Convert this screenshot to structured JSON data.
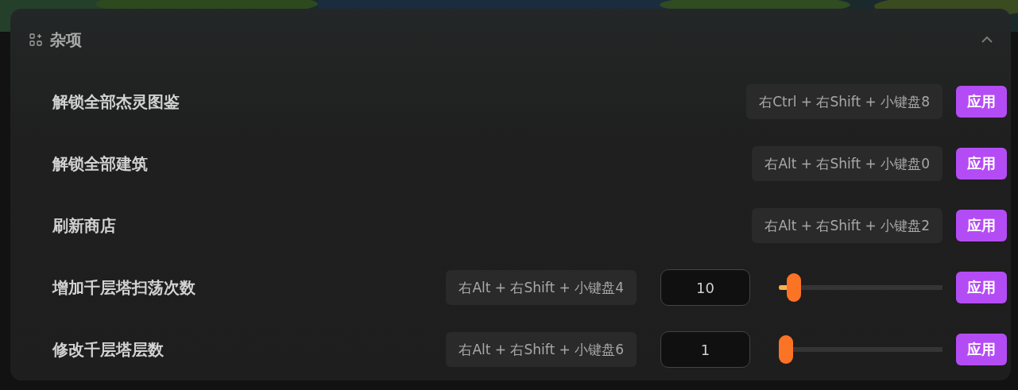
{
  "section": {
    "title": "杂项",
    "expanded": true
  },
  "rows": [
    {
      "kind": "hotkey",
      "label": "解锁全部杰灵图鉴",
      "hotkey": "右Ctrl + 右Shift + 小键盘8",
      "button": "应用"
    },
    {
      "kind": "hotkey",
      "label": "解锁全部建筑",
      "hotkey": "右Alt + 右Shift + 小键盘0",
      "button": "应用"
    },
    {
      "kind": "hotkey",
      "label": "刷新商店",
      "hotkey": "右Alt + 右Shift + 小键盘2",
      "button": "应用"
    },
    {
      "kind": "slider",
      "label": "增加千层塔扫荡次数",
      "hotkey": "右Alt + 右Shift + 小键盘4",
      "value": "10",
      "level": 0.09,
      "button": "应用"
    },
    {
      "kind": "slider",
      "label": "修改千层塔层数",
      "hotkey": "右Alt + 右Shift + 小键盘6",
      "value": "1",
      "level": 0,
      "button": "应用"
    }
  ]
}
